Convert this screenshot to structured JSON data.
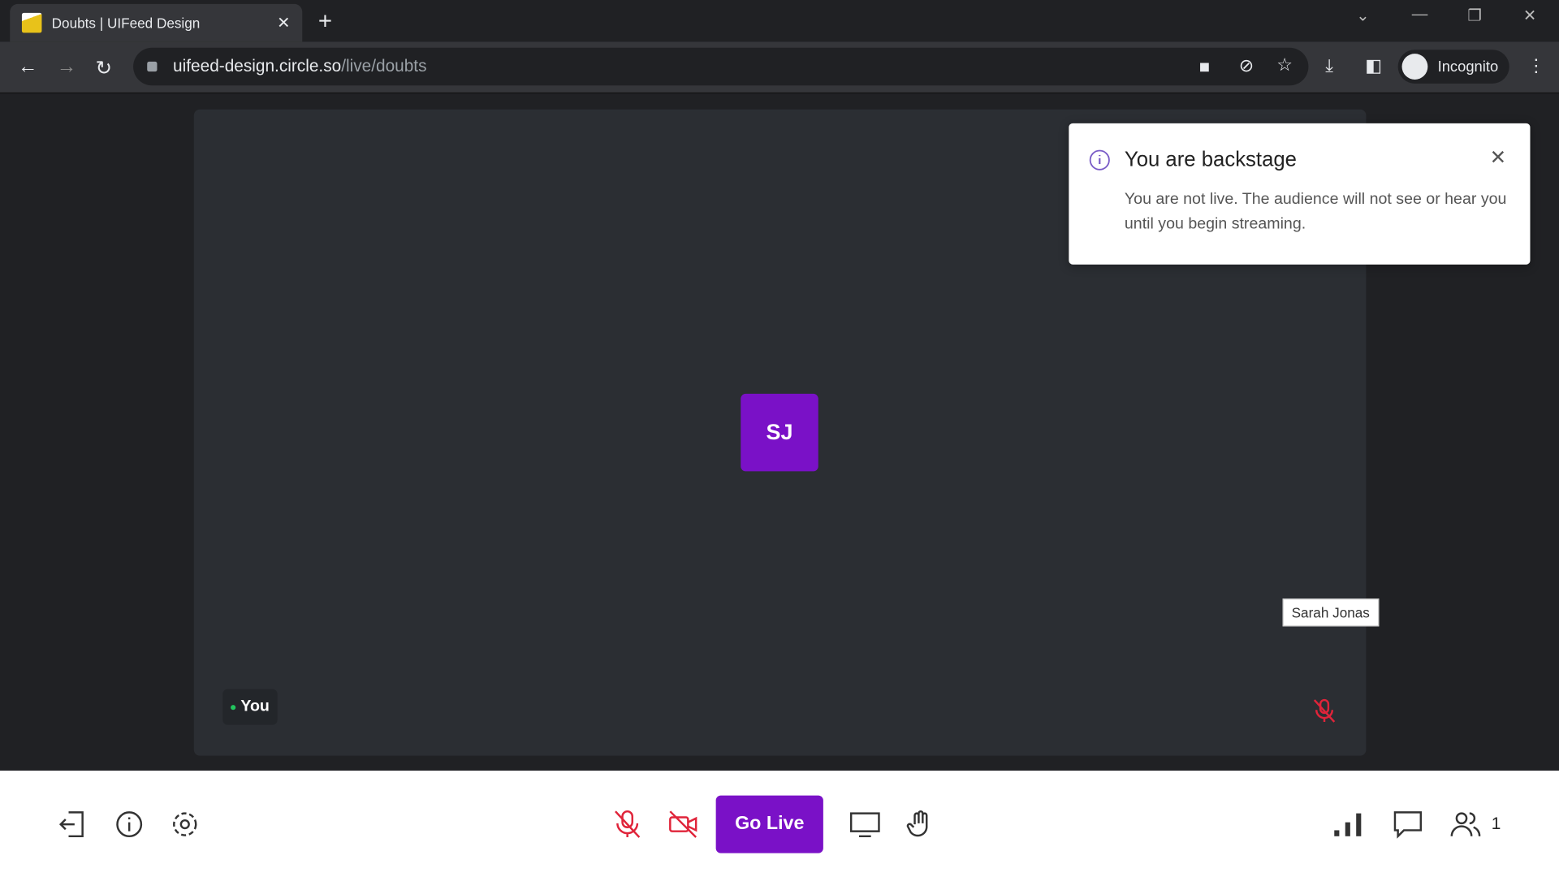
{
  "browser": {
    "tab_title": "Doubts | UIFeed Design",
    "url_host": "uifeed-design.circle.so",
    "url_path": "/live/doubts",
    "profile": "Incognito"
  },
  "stage": {
    "avatar_initials": "SJ",
    "self_label": "You",
    "tooltip": "Sarah Jonas"
  },
  "toast": {
    "title": "You are backstage",
    "message": "You are not live. The audience will not see or hear you until you begin streaming."
  },
  "controls": {
    "go_live": "Go Live",
    "participants_count": "1"
  },
  "colors": {
    "accent": "#7a11c7",
    "muted": "#e0243a"
  }
}
